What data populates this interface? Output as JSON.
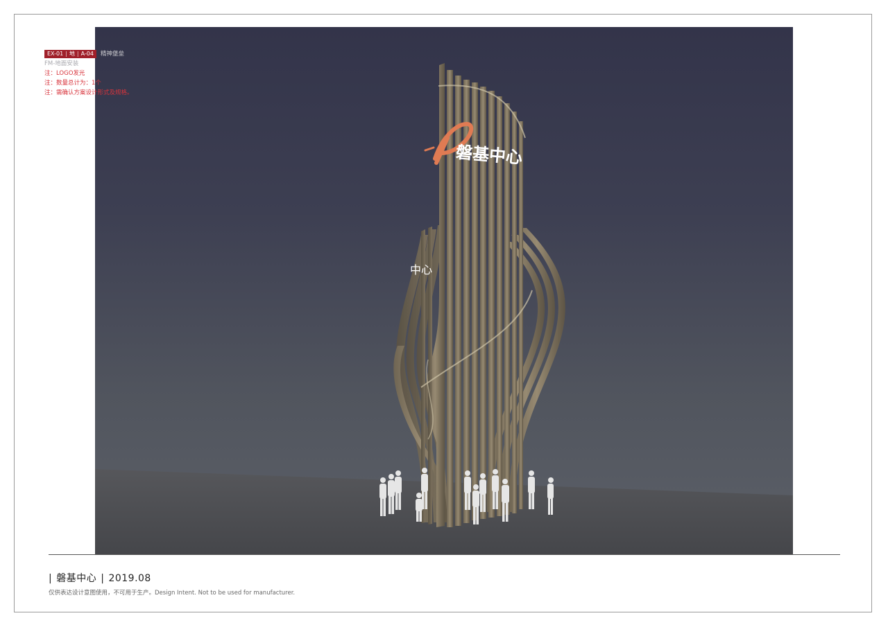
{
  "header": {
    "codes": [
      "EX-01",
      "地",
      "A-04"
    ],
    "code_title": "精神堡垒",
    "install_note": "FM-地面安装",
    "notes": [
      "注：LOGO发光",
      "注：数量总计为：1个",
      "注：需确认方案设计形式及规格。"
    ]
  },
  "render": {
    "sign_text": "磐基中心",
    "side_text": "中心",
    "logo_colors": {
      "accent": "#e07b53",
      "sky_top": "#34354a",
      "sky_bottom": "#5a5e66",
      "ground": "#4b4c50",
      "structure": "#8a7d68"
    }
  },
  "footer": {
    "brand": "磐基中心",
    "date": "2019.08",
    "disclaimer": "仅供表达设计意图使用，不可用于生产。Design Intent. Not to be used for manufacturer."
  }
}
